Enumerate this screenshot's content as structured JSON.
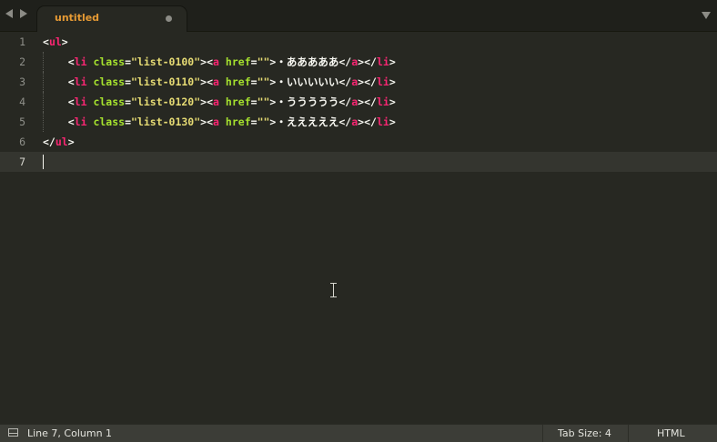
{
  "tabbar": {
    "tab_title": "untitled",
    "dirty_indicator": "dot-icon"
  },
  "editor": {
    "lines": [
      {
        "number": "1",
        "tokens": [
          {
            "t": "punct",
            "v": "<"
          },
          {
            "t": "tag",
            "v": "ul"
          },
          {
            "t": "punct",
            "v": ">"
          }
        ]
      },
      {
        "number": "2",
        "indent": "    ",
        "tokens": [
          {
            "t": "punct",
            "v": "<"
          },
          {
            "t": "tag",
            "v": "li"
          },
          {
            "t": "punct",
            "v": " "
          },
          {
            "t": "attr",
            "v": "class"
          },
          {
            "t": "punct",
            "v": "="
          },
          {
            "t": "str",
            "v": "\"list-0100\""
          },
          {
            "t": "punct",
            "v": ">"
          },
          {
            "t": "punct",
            "v": "<"
          },
          {
            "t": "tag",
            "v": "a"
          },
          {
            "t": "punct",
            "v": " "
          },
          {
            "t": "attr",
            "v": "href"
          },
          {
            "t": "punct",
            "v": "="
          },
          {
            "t": "str",
            "v": "\"\""
          },
          {
            "t": "punct",
            "v": ">"
          },
          {
            "t": "text",
            "v": "・あああああ"
          },
          {
            "t": "punct",
            "v": "</"
          },
          {
            "t": "tag",
            "v": "a"
          },
          {
            "t": "punct",
            "v": ">"
          },
          {
            "t": "punct",
            "v": "</"
          },
          {
            "t": "tag",
            "v": "li"
          },
          {
            "t": "punct",
            "v": ">"
          }
        ]
      },
      {
        "number": "3",
        "indent": "    ",
        "tokens": [
          {
            "t": "punct",
            "v": "<"
          },
          {
            "t": "tag",
            "v": "li"
          },
          {
            "t": "punct",
            "v": " "
          },
          {
            "t": "attr",
            "v": "class"
          },
          {
            "t": "punct",
            "v": "="
          },
          {
            "t": "str",
            "v": "\"list-0110\""
          },
          {
            "t": "punct",
            "v": ">"
          },
          {
            "t": "punct",
            "v": "<"
          },
          {
            "t": "tag",
            "v": "a"
          },
          {
            "t": "punct",
            "v": " "
          },
          {
            "t": "attr",
            "v": "href"
          },
          {
            "t": "punct",
            "v": "="
          },
          {
            "t": "str",
            "v": "\"\""
          },
          {
            "t": "punct",
            "v": ">"
          },
          {
            "t": "text",
            "v": "・いいいいい"
          },
          {
            "t": "punct",
            "v": "</"
          },
          {
            "t": "tag",
            "v": "a"
          },
          {
            "t": "punct",
            "v": ">"
          },
          {
            "t": "punct",
            "v": "</"
          },
          {
            "t": "tag",
            "v": "li"
          },
          {
            "t": "punct",
            "v": ">"
          }
        ]
      },
      {
        "number": "4",
        "indent": "    ",
        "tokens": [
          {
            "t": "punct",
            "v": "<"
          },
          {
            "t": "tag",
            "v": "li"
          },
          {
            "t": "punct",
            "v": " "
          },
          {
            "t": "attr",
            "v": "class"
          },
          {
            "t": "punct",
            "v": "="
          },
          {
            "t": "str",
            "v": "\"list-0120\""
          },
          {
            "t": "punct",
            "v": ">"
          },
          {
            "t": "punct",
            "v": "<"
          },
          {
            "t": "tag",
            "v": "a"
          },
          {
            "t": "punct",
            "v": " "
          },
          {
            "t": "attr",
            "v": "href"
          },
          {
            "t": "punct",
            "v": "="
          },
          {
            "t": "str",
            "v": "\"\""
          },
          {
            "t": "punct",
            "v": ">"
          },
          {
            "t": "text",
            "v": "・ううううう"
          },
          {
            "t": "punct",
            "v": "</"
          },
          {
            "t": "tag",
            "v": "a"
          },
          {
            "t": "punct",
            "v": ">"
          },
          {
            "t": "punct",
            "v": "</"
          },
          {
            "t": "tag",
            "v": "li"
          },
          {
            "t": "punct",
            "v": ">"
          }
        ]
      },
      {
        "number": "5",
        "indent": "    ",
        "tokens": [
          {
            "t": "punct",
            "v": "<"
          },
          {
            "t": "tag",
            "v": "li"
          },
          {
            "t": "punct",
            "v": " "
          },
          {
            "t": "attr",
            "v": "class"
          },
          {
            "t": "punct",
            "v": "="
          },
          {
            "t": "str",
            "v": "\"list-0130\""
          },
          {
            "t": "punct",
            "v": ">"
          },
          {
            "t": "punct",
            "v": "<"
          },
          {
            "t": "tag",
            "v": "a"
          },
          {
            "t": "punct",
            "v": " "
          },
          {
            "t": "attr",
            "v": "href"
          },
          {
            "t": "punct",
            "v": "="
          },
          {
            "t": "str",
            "v": "\"\""
          },
          {
            "t": "punct",
            "v": ">"
          },
          {
            "t": "text",
            "v": "・えええええ"
          },
          {
            "t": "punct",
            "v": "</"
          },
          {
            "t": "tag",
            "v": "a"
          },
          {
            "t": "punct",
            "v": ">"
          },
          {
            "t": "punct",
            "v": "</"
          },
          {
            "t": "tag",
            "v": "li"
          },
          {
            "t": "punct",
            "v": ">"
          }
        ]
      },
      {
        "number": "6",
        "tokens": [
          {
            "t": "punct",
            "v": "</"
          },
          {
            "t": "tag",
            "v": "ul"
          },
          {
            "t": "punct",
            "v": ">"
          }
        ]
      },
      {
        "number": "7",
        "tokens": [],
        "current": true
      }
    ]
  },
  "statusbar": {
    "position": "Line 7, Column 1",
    "tab_size": "Tab Size: 4",
    "syntax": "HTML"
  },
  "colors": {
    "background": "#272822",
    "tag": "#f92672",
    "attribute": "#a6e22e",
    "string": "#e6db74",
    "text": "#f8f8f2",
    "tab_title": "#e69a34"
  }
}
